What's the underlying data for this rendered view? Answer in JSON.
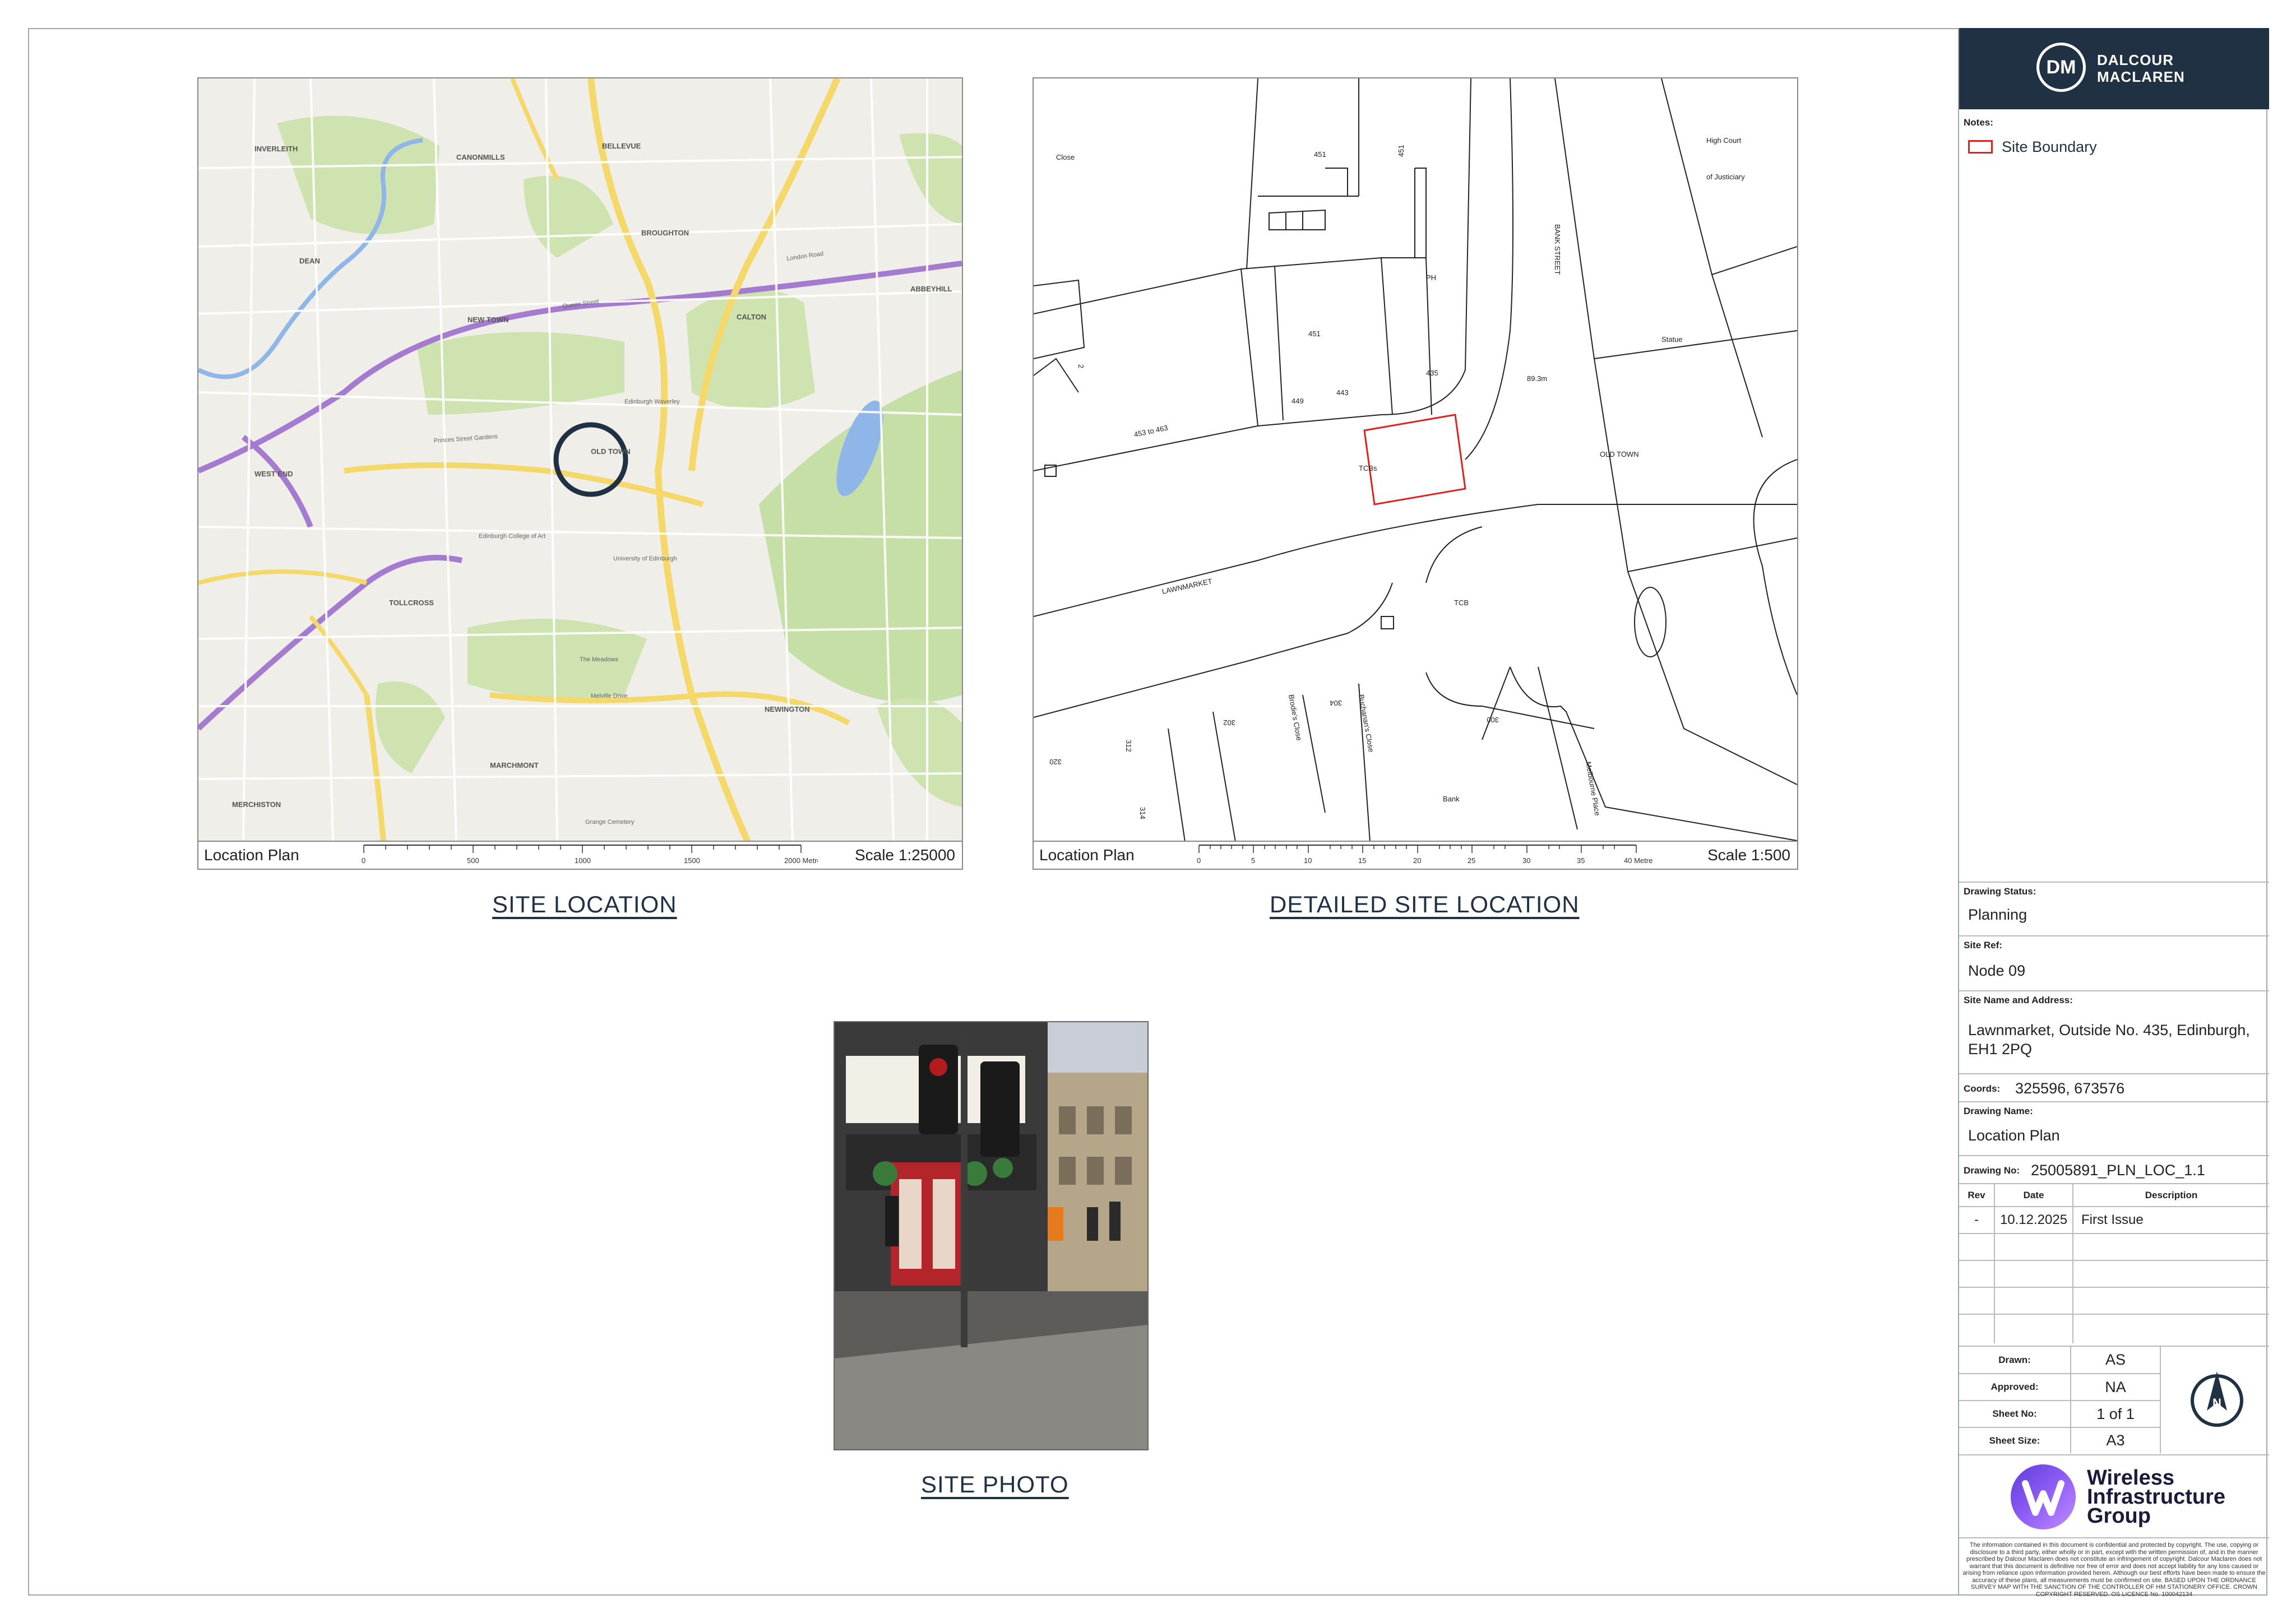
{
  "brand": {
    "initials": "DM",
    "line1": "DALCOUR",
    "line2": "MACLAREN",
    "color": "#1f3142"
  },
  "notes": {
    "label": "Notes:",
    "legend_label": "Site Boundary",
    "legend_color": "#d22"
  },
  "panels": {
    "site_location": {
      "footer_label": "Location Plan",
      "scale": "Scale 1:25000",
      "ticks": [
        "0",
        "500",
        "1000",
        "1500",
        "2000 Metres"
      ],
      "caption": "SITE LOCATION"
    },
    "detailed": {
      "footer_label": "Location Plan",
      "scale": "Scale 1:500",
      "ticks": [
        "0",
        "5",
        "10",
        "15",
        "20",
        "25",
        "30",
        "35",
        "40 Metres"
      ],
      "caption": "DETAILED SITE LOCATION"
    },
    "photo": {
      "caption": "SITE PHOTO"
    }
  },
  "map_labels": [
    "INVERLEITH",
    "CANONMILLS",
    "BELLEVUE",
    "BROUGHTON",
    "NEW TOWN",
    "CALTON",
    "DEAN",
    "WEST END",
    "OLD TOWN",
    "TOLLCROSS",
    "MARCHMONT",
    "NEWINGTON",
    "MERCHISTON",
    "ABBEYHILL",
    "Queen Street",
    "London Road",
    "Edinburgh Waverley",
    "The Meadows",
    "Princes Street Gardens",
    "Melville Drive",
    "Edinburgh College of Art",
    "University of Edinburgh",
    "Grange Cemetery"
  ],
  "detail_labels": [
    "451",
    "451",
    "PH",
    "451",
    "449",
    "443",
    "435",
    "453 to 463",
    "TCBs",
    "89.3m",
    "BANK STREET",
    "Statue",
    "OLD TOWN",
    "LAWNMARKET",
    "TCB",
    "High Court",
    "of Justiciary",
    "Close",
    "302",
    "304",
    "300",
    "Bank",
    "Brodie's Close",
    "Buchanan's Close",
    "Melbourne Place",
    "312",
    "314",
    "320",
    "2"
  ],
  "drawing_status": {
    "label": "Drawing Status:",
    "value": "Planning"
  },
  "site_ref": {
    "label": "Site Ref:",
    "value": "Node 09"
  },
  "site_name": {
    "label": "Site Name and Address:",
    "line1": "Lawnmarket, Outside No. 435, Edinburgh,",
    "line2": "EH1 2PQ"
  },
  "coords": {
    "label": "Coords:",
    "value": "325596, 673576"
  },
  "drawing_name": {
    "label": "Drawing Name:",
    "value": "Location Plan"
  },
  "drawing_no": {
    "label": "Drawing No:",
    "value": "25005891_PLN_LOC_1.1"
  },
  "revisions": {
    "headers": [
      "Rev",
      "Date",
      "Description"
    ],
    "rows": [
      [
        "-",
        "10.12.2025",
        "First Issue"
      ]
    ]
  },
  "signoff": [
    {
      "label": "Drawn:",
      "value": "AS"
    },
    {
      "label": "Approved:",
      "value": "NA"
    },
    {
      "label": "Sheet No:",
      "value": "1 of 1"
    },
    {
      "label": "Sheet Size:",
      "value": "A3"
    }
  ],
  "north_label": "N",
  "client": {
    "line1": "Wireless",
    "line2": "Infrastructure",
    "line3": "Group",
    "colors": [
      "#5b3fd6",
      "#8f5cf7",
      "#c08cff"
    ]
  },
  "disclaimer": "The information contained in this document is confidential and protected by copyright. The use, copying or disclosure to a third party, either wholly or in part, except with the written permission of, and in the manner prescribed by Dalcour Maclaren does not constitute an infringement of copyright. Dalcour Maclaren does not warrant that this document is definitive nor free of error and does not accept liability for any loss caused or arising from reliance upon information provided herein. Although our best efforts have been made to ensure the accuracy of these plans, all measurements must be confirmed on site. BASED UPON THE ORDNANCE SURVEY MAP WITH THE SANCTION OF THE CONTROLLER OF HM STATIONERY OFFICE. CROWN COPYRIGHT RESERVED. OS LICENCE No. 100042134"
}
